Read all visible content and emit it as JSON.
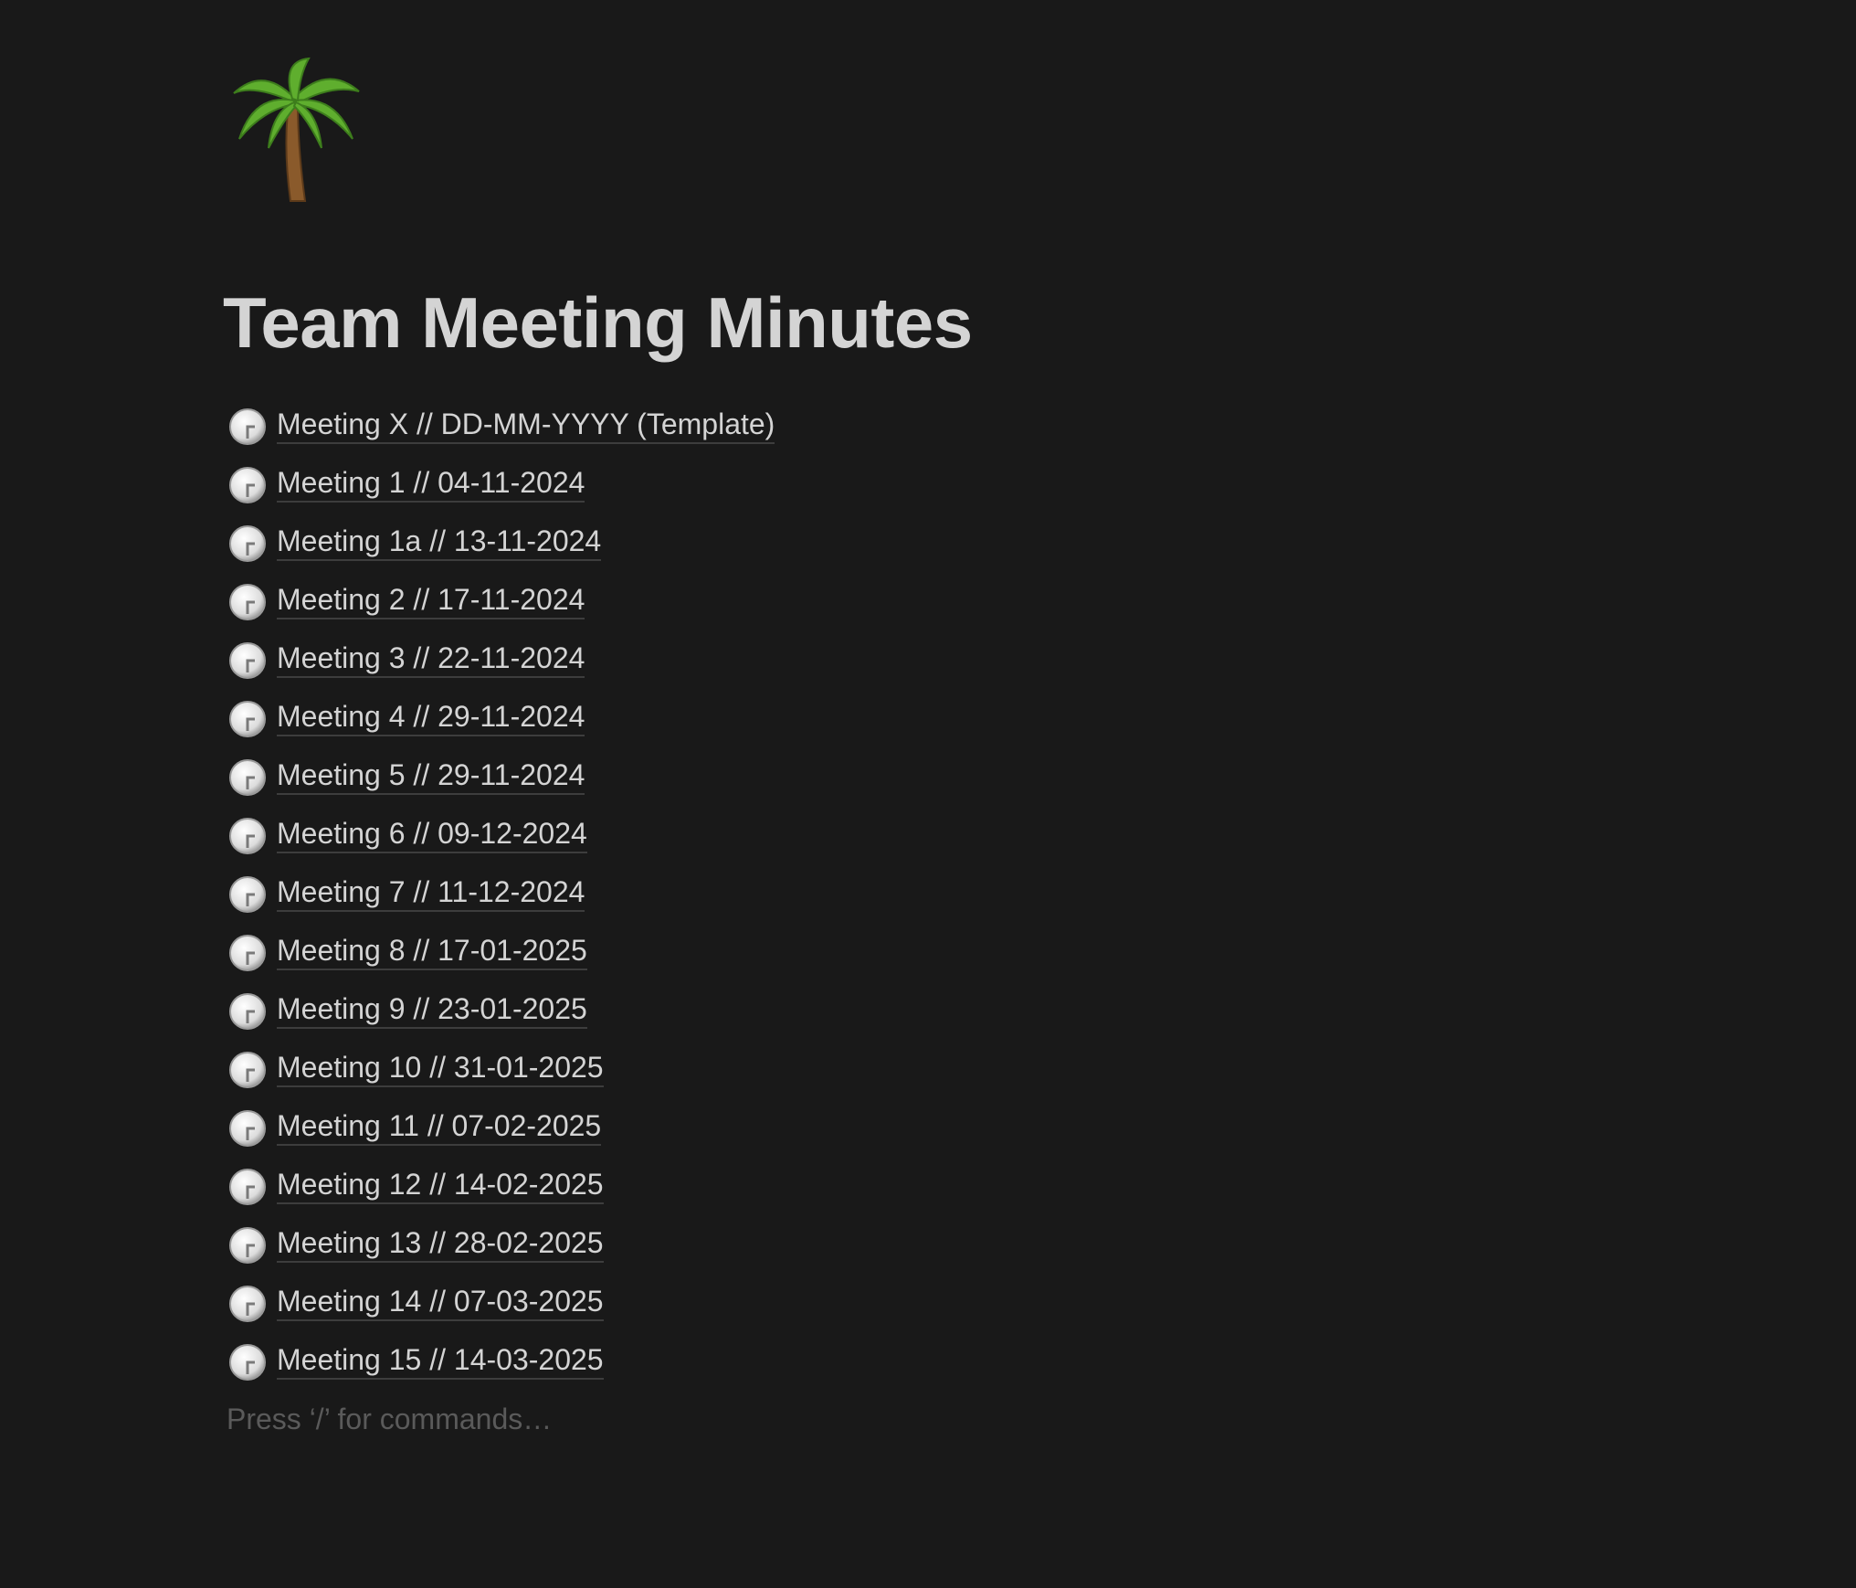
{
  "page": {
    "icon": "palm-tree-emoji",
    "title": "Team Meeting Minutes",
    "items": [
      {
        "label": "Meeting X // DD-MM-YYYY (Template)",
        "icon": "clock-icon"
      },
      {
        "label": "Meeting 1 // 04-11-2024",
        "icon": "clock-icon"
      },
      {
        "label": "Meeting 1a // 13-11-2024",
        "icon": "clock-icon"
      },
      {
        "label": "Meeting 2 // 17-11-2024",
        "icon": "clock-icon"
      },
      {
        "label": "Meeting 3 // 22-11-2024",
        "icon": "clock-icon"
      },
      {
        "label": "Meeting 4 // 29-11-2024",
        "icon": "clock-icon"
      },
      {
        "label": "Meeting 5 // 29-11-2024",
        "icon": "clock-icon"
      },
      {
        "label": "Meeting 6 // 09-12-2024",
        "icon": "clock-icon"
      },
      {
        "label": "Meeting 7 // 11-12-2024",
        "icon": "clock-icon"
      },
      {
        "label": "Meeting 8 // 17-01-2025",
        "icon": "clock-icon"
      },
      {
        "label": "Meeting 9 // 23-01-2025",
        "icon": "clock-icon"
      },
      {
        "label": "Meeting 10 // 31-01-2025",
        "icon": "clock-icon"
      },
      {
        "label": "Meeting 11 // 07-02-2025",
        "icon": "clock-icon"
      },
      {
        "label": "Meeting 12 // 14-02-2025",
        "icon": "clock-icon"
      },
      {
        "label": "Meeting 13 // 28-02-2025",
        "icon": "clock-icon"
      },
      {
        "label": "Meeting 14 // 07-03-2025",
        "icon": "clock-icon"
      },
      {
        "label": "Meeting 15 // 14-03-2025",
        "icon": "clock-icon"
      }
    ],
    "placeholder": "Press ‘/’ for commands…"
  },
  "colors": {
    "background": "#191919",
    "text": "#d4d4d4",
    "placeholder": "#5a5a5a",
    "underline": "#3d3d3d"
  }
}
